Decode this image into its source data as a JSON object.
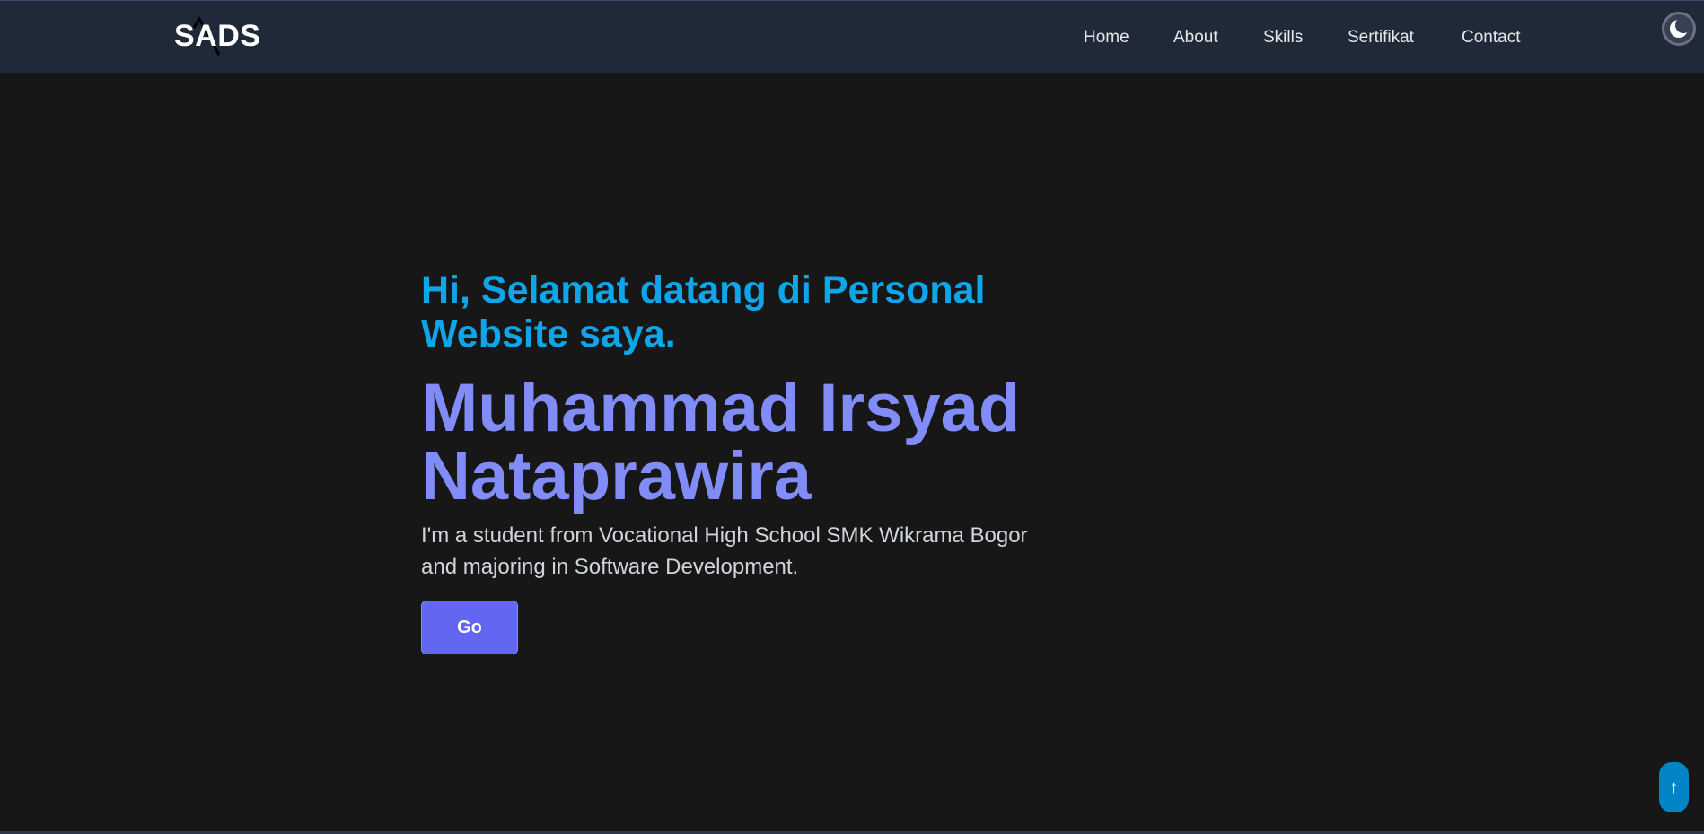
{
  "navbar": {
    "logo": "SADS",
    "links": [
      {
        "label": "Home"
      },
      {
        "label": "About"
      },
      {
        "label": "Skills"
      },
      {
        "label": "Sertifikat"
      },
      {
        "label": "Contact"
      }
    ],
    "theme_toggle_icon": "moon-icon"
  },
  "hero": {
    "greeting": "Hi, Selamat datang di Personal Website saya.",
    "name": "Muhammad Irsyad Nataprawira",
    "description": "I'm a student from Vocational High School SMK Wikrama Bogor and majoring in Software Development.",
    "button_label": "Go"
  },
  "scroll_top": {
    "icon": "arrow-up-icon",
    "glyph": "↑"
  },
  "colors": {
    "background": "#171717",
    "navbar": "#1f2937",
    "greeting": "#0ea5e9",
    "name": "#818cf8",
    "button": "#6366f1",
    "scroll_top": "#0284c7"
  }
}
